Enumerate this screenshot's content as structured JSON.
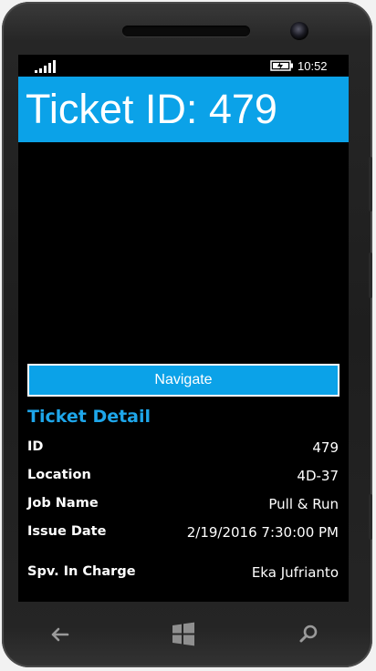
{
  "status_bar": {
    "time": "10:52"
  },
  "header": {
    "title": "Ticket ID: 479"
  },
  "navigate_button": {
    "label": "Navigate"
  },
  "section": {
    "title": "Ticket Detail"
  },
  "details": [
    {
      "label": "ID",
      "value": "479"
    },
    {
      "label": "Location",
      "value": "4D-37"
    },
    {
      "label": "Job Name",
      "value": "Pull & Run"
    },
    {
      "label": "Issue Date",
      "value": "2/19/2016 7:30:00 PM"
    },
    {
      "label": "Spv. In Charge",
      "value": "Eka Jufrianto"
    }
  ],
  "icons": {
    "signal": "signal-strength-icon",
    "battery": "battery-charging-icon",
    "back": "back-arrow-icon",
    "start": "windows-start-icon",
    "search": "search-icon"
  },
  "colors": {
    "accent": "#0ba2e8",
    "section_title": "#1ea6ea",
    "screen_bg": "#000000"
  }
}
